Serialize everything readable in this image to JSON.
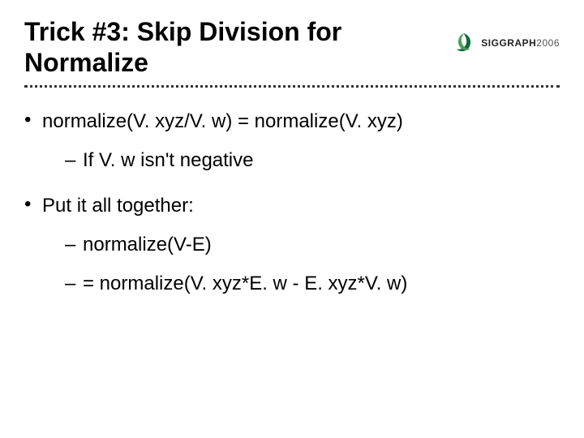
{
  "title": "Trick #3: Skip Division for Normalize",
  "brand": {
    "name_bold": "SIGGRAPH",
    "name_light": "2006",
    "logo_colors": {
      "dark": "#0b6b3a",
      "light": "#4aa05a"
    }
  },
  "bullets": [
    {
      "text": "normalize(V. xyz/V. w) = normalize(V. xyz)",
      "sub": [
        {
          "text": "If V. w isn't negative"
        }
      ]
    },
    {
      "text": "Put it all together:",
      "sub": [
        {
          "text": "normalize(V-E)"
        },
        {
          "text": "= normalize(V. xyz*E. w - E. xyz*V. w)"
        }
      ]
    }
  ]
}
